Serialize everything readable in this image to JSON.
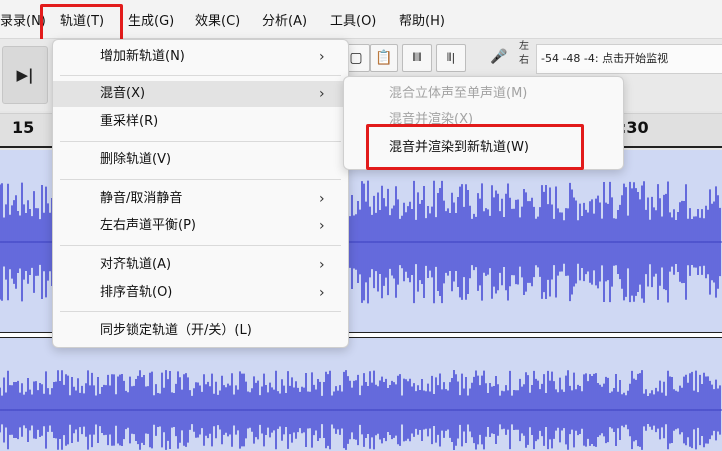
{
  "menubar": {
    "items": [
      {
        "label": "录录(N)"
      },
      {
        "label": "轨道(T)"
      },
      {
        "label": "生成(G)"
      },
      {
        "label": "效果(C)"
      },
      {
        "label": "分析(A)"
      },
      {
        "label": "工具(O)"
      },
      {
        "label": "帮助(H)"
      }
    ]
  },
  "toolbar": {
    "play_end_glyph": "▶|",
    "lr_label_top": "左",
    "lr_label_bottom": "右",
    "meter_text": "-54  -48  -4:  点击开始监视"
  },
  "ruler": {
    "left_label": "15",
    "right_label": ":30"
  },
  "track_menu": {
    "items": [
      {
        "label": "增加新轨道(N)",
        "submenu": true
      },
      {
        "label": "混音(X)",
        "submenu": true
      },
      {
        "label": "重采样(R)",
        "submenu": false
      },
      {
        "label": "删除轨道(V)",
        "submenu": false
      },
      {
        "label": "静音/取消静音",
        "submenu": true
      },
      {
        "label": "左右声道平衡(P)",
        "submenu": true
      },
      {
        "label": "对齐轨道(A)",
        "submenu": true
      },
      {
        "label": "排序音轨(O)",
        "submenu": true
      },
      {
        "label": "同步锁定轨道（开/关）(L)",
        "submenu": false
      }
    ]
  },
  "mix_submenu": {
    "items": [
      {
        "label": "混合立体声至单声道(M)",
        "enabled": false
      },
      {
        "label": "混音并渲染(X)",
        "enabled": false
      },
      {
        "label": "混音并渲染到新轨道(W)",
        "enabled": true
      }
    ]
  },
  "colors": {
    "highlight_red": "#e21b1b",
    "waveform_blue": "#4a4fd6",
    "track_bg": "#cfd8f3"
  }
}
